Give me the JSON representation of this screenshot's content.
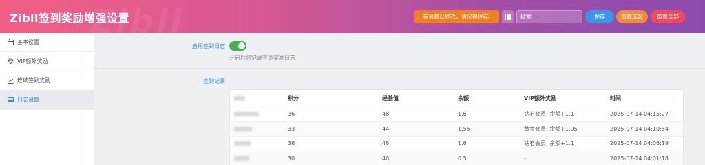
{
  "header": {
    "title": "Zibll签到奖励增强设置",
    "watermark": "Zibll",
    "notice": "有设置已修改，请记得保存!",
    "search_placeholder": "搜索...",
    "save_label": "保存",
    "reset_section_label": "重置选区",
    "reset_all_label": "重置全部"
  },
  "sidebar": {
    "items": [
      {
        "label": "基本设置",
        "icon": "calendar-icon",
        "active": false
      },
      {
        "label": "VIP额外奖励",
        "icon": "diamond-icon",
        "active": false
      },
      {
        "label": "连续签到奖励",
        "icon": "chart-line-icon",
        "active": false
      },
      {
        "label": "日志设置",
        "icon": "list-icon",
        "active": true
      }
    ]
  },
  "settings": {
    "enable_log": {
      "label": "启用签到日志",
      "enabled": true,
      "hint": "开启后将记录签到奖励日志"
    },
    "records": {
      "label": "签到记录"
    }
  },
  "table": {
    "columns": [
      "",
      "积分",
      "经验值",
      "余额",
      "VIP额外奖励",
      "时间"
    ],
    "rows": [
      {
        "points": "36",
        "exp": "48",
        "balance": "1.6",
        "vip": "钻石会员: 余额+1.1",
        "time": "2025-07-14 04:15:27"
      },
      {
        "points": "33",
        "exp": "44",
        "balance": "1.55",
        "vip": "黄金会员: 余额+1.05",
        "time": "2025-07-14 04:10:54"
      },
      {
        "points": "36",
        "exp": "48",
        "balance": "1.6",
        "vip": "钻石会员: 余额+1.1",
        "time": "2025-07-14 04:06:19"
      },
      {
        "points": "30",
        "exp": "40",
        "balance": "0.5",
        "vip": "-",
        "time": "2025-07-14 04:01:18"
      }
    ]
  },
  "colors": {
    "accent": "#2d8ee6",
    "toggle_on": "#3eb356",
    "notice": "#f08021",
    "save": "#3a97e8",
    "reset_section": "#f28a37",
    "reset_all": "#ef4a5c"
  }
}
